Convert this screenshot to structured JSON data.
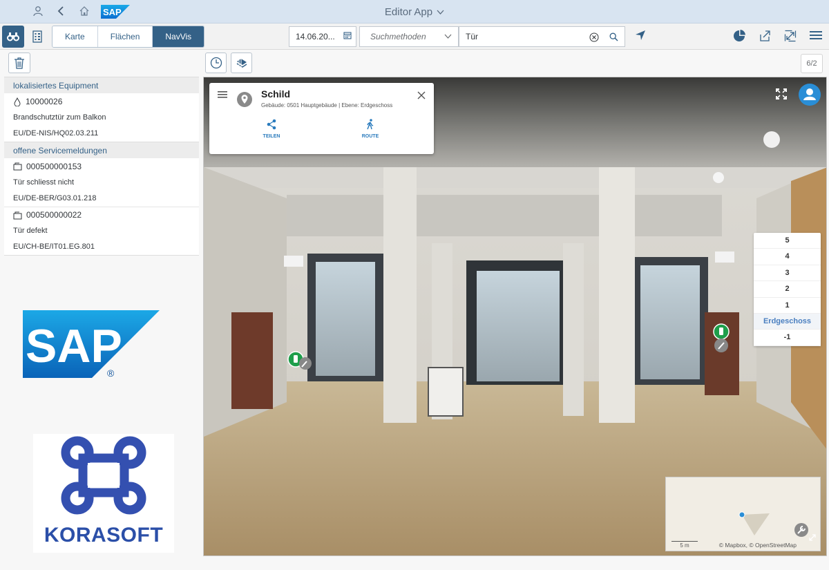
{
  "shell": {
    "title": "Editor App",
    "sap_label": "SAP"
  },
  "toolbar": {
    "tabs": [
      {
        "label": "Karte",
        "selected": false
      },
      {
        "label": "Flächen",
        "selected": false
      },
      {
        "label": "NavVis",
        "selected": true
      }
    ],
    "date_value": "14.06.20...",
    "search_method_placeholder": "Suchmethoden",
    "search_value": "Tür"
  },
  "list": {
    "groups": [
      {
        "title": "lokalisiertes Equipment",
        "items": [
          {
            "id": "10000026",
            "description": "Brandschutztür zum Balkon",
            "location": "EU/DE-NIS/HQ02.03.211"
          }
        ]
      },
      {
        "title": "offene Servicemeldungen",
        "items": [
          {
            "id": "000500000153",
            "description": "Tür schliesst nicht",
            "location": "EU/DE-BER/G03.01.218"
          },
          {
            "id": "000500000022",
            "description": "Tür defekt",
            "location": "EU/CH-BE/IT01.EG.801"
          }
        ]
      }
    ]
  },
  "logos": {
    "sap_text": "SAP",
    "registered": "®",
    "korasoft_text": "KORASOFT"
  },
  "main": {
    "pager": "6/2"
  },
  "info_card": {
    "title": "Schild",
    "subtitle": "Gebäude: 0501 Hauptgebäude | Ebene: Erdgeschoss",
    "share_label": "TEILEN",
    "route_label": "ROUTE"
  },
  "floors": [
    "5",
    "4",
    "3",
    "2",
    "1",
    "Erdgeschoss",
    "-1"
  ],
  "floors_selected": "Erdgeschoss",
  "minimap": {
    "scale": "5 m",
    "attribution": "© Mapbox, © OpenStreetMap"
  },
  "colors": {
    "accent": "#346187",
    "shell": "#d8e4f1",
    "marker_green": "#1e9e4a",
    "floor_selected": "#4a7fc0"
  }
}
